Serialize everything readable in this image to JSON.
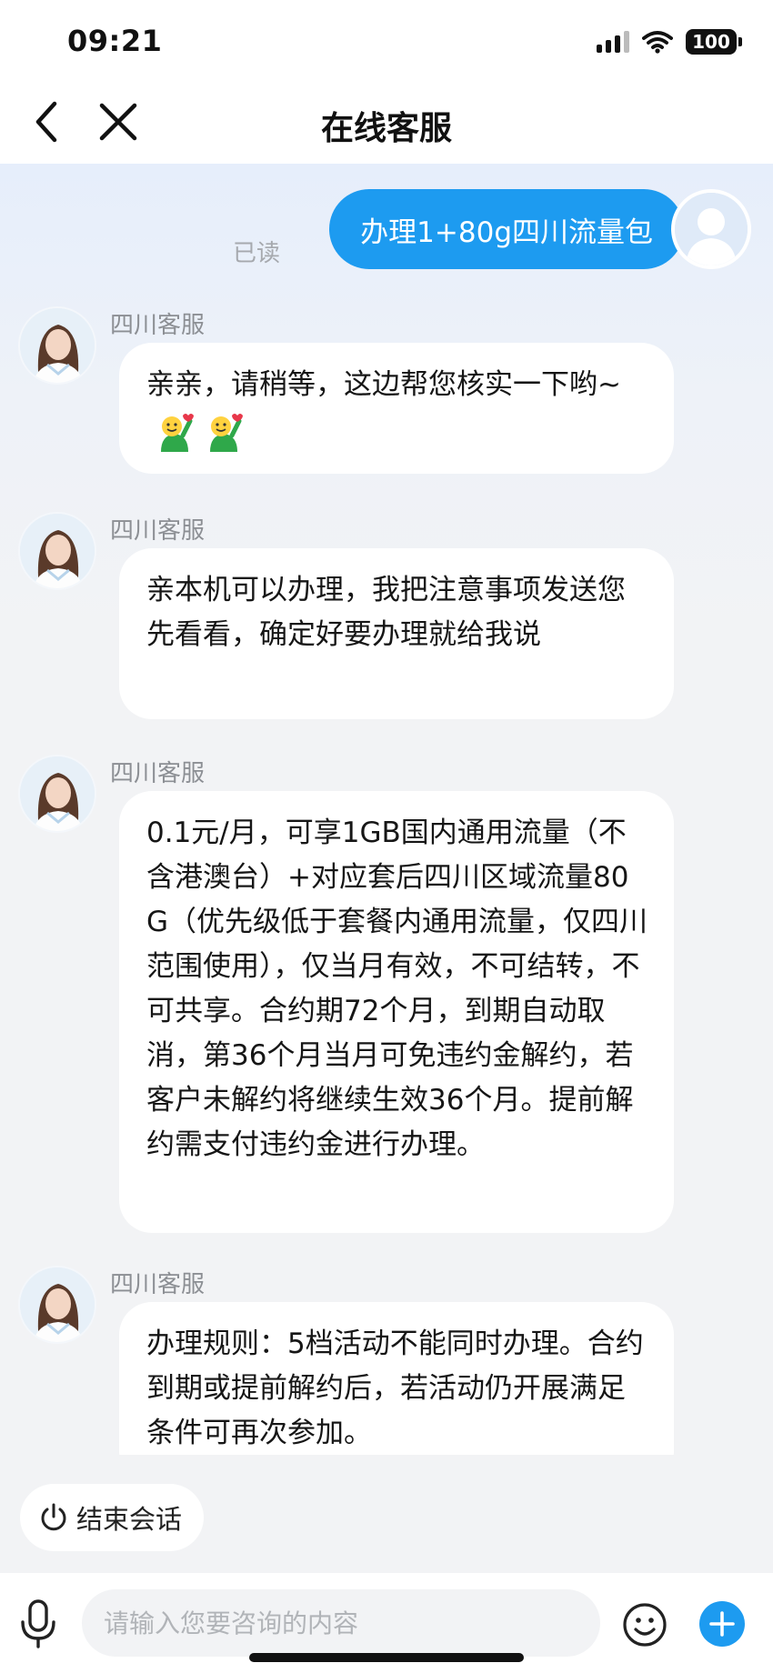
{
  "status_bar": {
    "time": "09:21",
    "battery": "100"
  },
  "nav": {
    "title": "在线客服"
  },
  "chat": {
    "user_message": {
      "text": "办理1+80g四川流量包",
      "read_status": "已读"
    },
    "agent_messages": [
      {
        "sender": "四川客服",
        "text": "亲亲，请稍等，这边帮您核实一下哟~",
        "emoji": [
          "waving-heart-emoji",
          "waving-heart-emoji"
        ]
      },
      {
        "sender": "四川客服",
        "text": "亲本机可以办理，我把注意事项发送您先看看，确定好要办理就给我说"
      },
      {
        "sender": "四川客服",
        "text": "0.1元/月，可享1GB国内通用流量（不含港澳台）+对应套后四川区域流量80G（优先级低于套餐内通用流量，仅四川范围使用），仅当月有效，不可结转，不可共享。合约期72个月，到期自动取消，第36个月当月可免违约金解约，若客户未解约将继续生效36个月。提前解约需支付违约金进行办理。"
      },
      {
        "sender": "四川客服",
        "text": "办理规则：5档活动不能同时办理。合约到期或提前解约后，若活动仍开展满足条件可再次参加。"
      }
    ]
  },
  "end_session_label": "结束会话",
  "input": {
    "placeholder": "请输入您要咨询的内容"
  },
  "colors": {
    "accent": "#1d9bf0",
    "background": "#f2f3f5"
  }
}
